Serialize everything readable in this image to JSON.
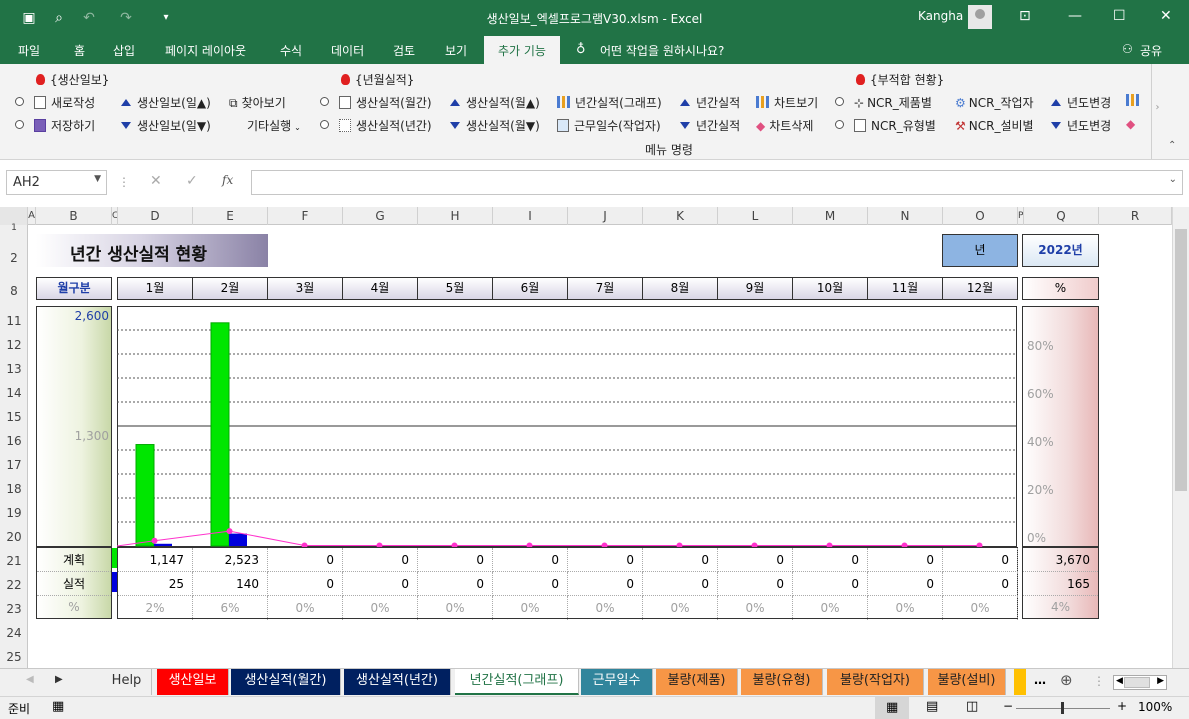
{
  "window": {
    "title": "생산일보_엑셀프로그램V30.xlsm  -  Excel",
    "user": "Kangha"
  },
  "menu": {
    "tabs": [
      "파일",
      "홈",
      "삽입",
      "페이지 레이아웃",
      "수식",
      "데이터",
      "검토",
      "보기"
    ],
    "active_tab": "추가 기능",
    "tell_me": "어떤 작업을 원하시나요?",
    "share": "공유"
  },
  "ribbon": {
    "group1_title": "{생산일보}",
    "group2_title": "{년월실적}",
    "group3_title": "{부적합 현황}",
    "new": "새로작성",
    "save": "저장하기",
    "daily_up": "생산일보(일▲)",
    "daily_down": "생산일보(일▼)",
    "find": "찾아보기",
    "other": "기타실행",
    "monthly": "생산실적(월간)",
    "yearly": "생산실적(년간)",
    "month_up": "생산실적(월▲)",
    "month_down": "생산실적(월▼)",
    "annual_graph": "년간실적(그래프)",
    "work_days": "근무일수(작업자)",
    "annual_up": "년간실적",
    "annual_down": "년간실적",
    "chart_view": "차트보기",
    "chart_delete": "차트삭제",
    "ncr_product": "NCR_제품별",
    "ncr_type": "NCR_유형별",
    "ncr_worker": "NCR_작업자",
    "ncr_equip": "NCR_설비별",
    "year_change1": "년도변경",
    "year_change2": "년도변경",
    "group_label": "메뉴 명령"
  },
  "formula_bar": {
    "name_box": "AH2",
    "fx": "fx",
    "formula": ""
  },
  "columns": [
    "A",
    "B",
    "C",
    "D",
    "E",
    "F",
    "G",
    "H",
    "I",
    "J",
    "K",
    "L",
    "M",
    "N",
    "O",
    "P",
    "Q",
    "R"
  ],
  "rows": [
    "1",
    "2",
    "8",
    "11",
    "12",
    "13",
    "14",
    "15",
    "16",
    "17",
    "18",
    "19",
    "20",
    "21",
    "22",
    "23",
    "24",
    "25"
  ],
  "sheet": {
    "title": "년간 생산실적 현황",
    "year_label": "년",
    "year_value": "2022년",
    "month_header": "월구분",
    "pct_header": "%",
    "months": [
      "1월",
      "2월",
      "3월",
      "4월",
      "5월",
      "6월",
      "7월",
      "8월",
      "9월",
      "10월",
      "11월",
      "12월"
    ],
    "plan_label": "계획",
    "actual_label": "실적",
    "pct_label": "%",
    "plan": [
      "1,147",
      "2,523",
      "0",
      "0",
      "0",
      "0",
      "0",
      "0",
      "0",
      "0",
      "0",
      "0"
    ],
    "actual": [
      "25",
      "140",
      "0",
      "0",
      "0",
      "0",
      "0",
      "0",
      "0",
      "0",
      "0",
      "0"
    ],
    "pct": [
      "2%",
      "6%",
      "0%",
      "0%",
      "0%",
      "0%",
      "0%",
      "0%",
      "0%",
      "0%",
      "0%",
      "0%"
    ],
    "total_plan": "3,670",
    "total_actual": "165",
    "total_pct": "4%"
  },
  "chart_data": {
    "type": "bar",
    "categories": [
      "1월",
      "2월",
      "3월",
      "4월",
      "5월",
      "6월",
      "7월",
      "8월",
      "9월",
      "10월",
      "11월",
      "12월"
    ],
    "series": [
      {
        "name": "계획",
        "values": [
          1147,
          2523,
          0,
          0,
          0,
          0,
          0,
          0,
          0,
          0,
          0,
          0
        ],
        "color": "#00e600"
      },
      {
        "name": "실적",
        "values": [
          25,
          140,
          0,
          0,
          0,
          0,
          0,
          0,
          0,
          0,
          0,
          0
        ],
        "color": "#0000dd"
      },
      {
        "name": "%",
        "values": [
          2,
          6,
          0,
          0,
          0,
          0,
          0,
          0,
          0,
          0,
          0,
          0
        ],
        "type": "line",
        "color": "#ff33cc"
      }
    ],
    "y_left_ticks": [
      "2,600",
      "1,300"
    ],
    "y_left_lim": [
      0,
      2600
    ],
    "y_right_ticks": [
      "80%",
      "60%",
      "40%",
      "20%",
      "0%"
    ],
    "y_right_lim": [
      0,
      100
    ]
  },
  "sheet_tabs": [
    {
      "label": "Help",
      "bg": "#f0f0f0",
      "fg": "#333333"
    },
    {
      "label": "생산일보",
      "bg": "#ff0000",
      "fg": "#ffffff"
    },
    {
      "label": "생산실적(월간)",
      "bg": "#002060",
      "fg": "#ffffff"
    },
    {
      "label": "생산실적(년간)",
      "bg": "#002060",
      "fg": "#ffffff"
    },
    {
      "label": "년간실적(그래프)",
      "bg": "#ffffff",
      "fg": "#217346"
    },
    {
      "label": "근무일수",
      "bg": "#31859c",
      "fg": "#ffffff"
    },
    {
      "label": "불량(제품)",
      "bg": "#f79646",
      "fg": "#222222"
    },
    {
      "label": "불량(유형)",
      "bg": "#f79646",
      "fg": "#222222"
    },
    {
      "label": "불량(작업자)",
      "bg": "#f79646",
      "fg": "#222222"
    },
    {
      "label": "불량(설비)",
      "bg": "#f79646",
      "fg": "#222222"
    }
  ],
  "status": {
    "ready": "준비",
    "zoom": "100%"
  }
}
